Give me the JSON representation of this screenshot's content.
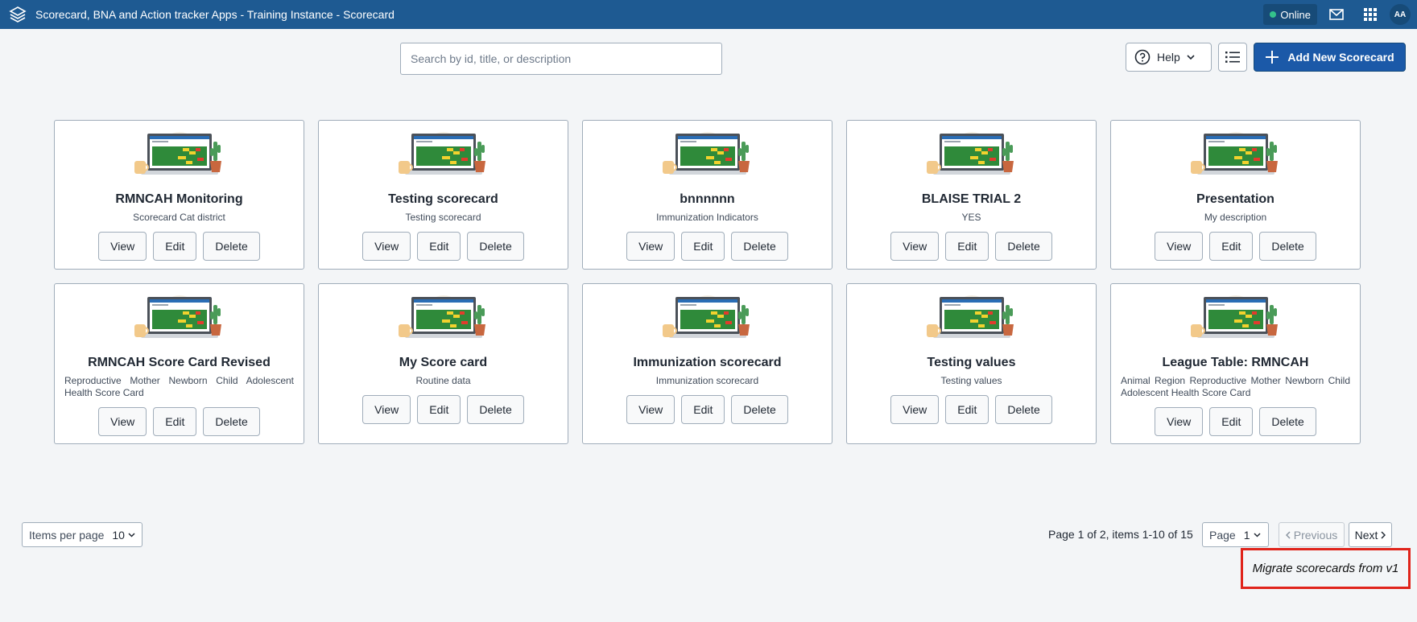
{
  "header": {
    "title": "Scorecard, BNA and Action tracker Apps - Training Instance - Scorecard",
    "status": "Online",
    "avatar_initials": "AA",
    "icons": [
      "app-logo-icon",
      "mail-icon",
      "apps-grid-icon"
    ]
  },
  "toolbar": {
    "search_placeholder": "Search by id, title, or description",
    "search_value": "",
    "help_label": "Help",
    "add_label": "Add New Scorecard"
  },
  "cards": [
    {
      "title": "RMNCAH Monitoring",
      "description": "Scorecard Cat district"
    },
    {
      "title": "Testing scorecard",
      "description": "Testing scorecard"
    },
    {
      "title": "bnnnnnn",
      "description": "Immunization Indicators"
    },
    {
      "title": "BLAISE TRIAL 2",
      "description": "YES"
    },
    {
      "title": "Presentation",
      "description": "My description"
    },
    {
      "title": "RMNCAH Score Card Revised",
      "description": "Reproductive Mother Newborn Child Adolescent Health Score Card"
    },
    {
      "title": "My Score card",
      "description": "Routine data"
    },
    {
      "title": "Immunization scorecard",
      "description": "Immunization scorecard"
    },
    {
      "title": "Testing values",
      "description": "Testing values"
    },
    {
      "title": "League Table: RMNCAH",
      "description": "Animal Region Reproductive Mother Newborn Child Adolescent Health Score Card"
    }
  ],
  "card_actions": {
    "view": "View",
    "edit": "Edit",
    "delete": "Delete"
  },
  "pagination": {
    "items_per_page_label": "Items per page",
    "items_per_page_value": "10",
    "summary": "Page 1 of 2, items 1-10 of 15",
    "page_label": "Page",
    "page_value": "1",
    "previous_label": "Previous",
    "next_label": "Next"
  },
  "migrate_label": "Migrate scorecards from v1",
  "colors": {
    "header": "#1e5a92",
    "primary_button": "#1b59a8",
    "highlight_border": "#e0241b",
    "online_dot": "#34c28b"
  }
}
